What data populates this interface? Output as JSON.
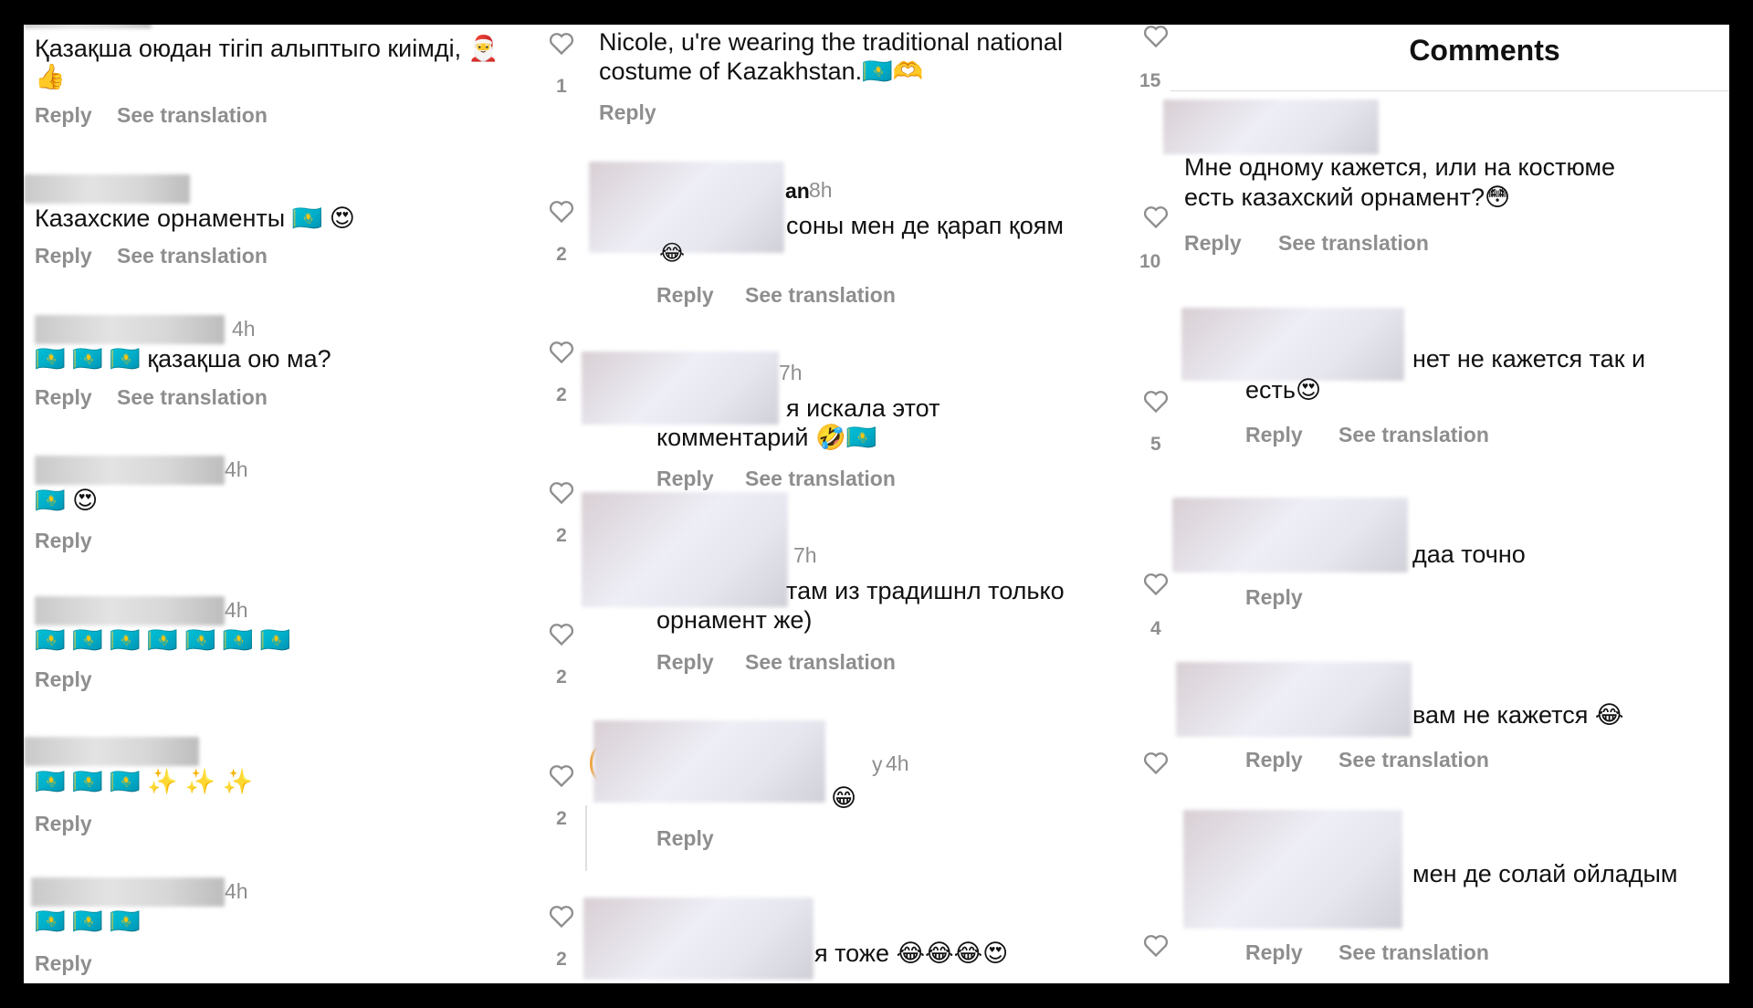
{
  "header": {
    "title": "Comments"
  },
  "actions": {
    "reply": "Reply",
    "see_translation": "See translation"
  },
  "col1": {
    "c1": {
      "text": "Қазақша оюдан тігіп алыптыго киімді, 🎅",
      "text2": "👍"
    },
    "c2": {
      "text": "Казахские орнаменты 🇰🇿 😍"
    },
    "c3": {
      "time": "4h",
      "text": "🇰🇿 🇰🇿 🇰🇿 қазақша ою ма?"
    },
    "c4": {
      "time": "4h",
      "text": "🇰🇿 😍"
    },
    "c5": {
      "time": "4h",
      "text": "🇰🇿 🇰🇿 🇰🇿 🇰🇿 🇰🇿 🇰🇿 🇰🇿"
    },
    "c6": {
      "text": "🇰🇿 🇰🇿 🇰🇿 ✨ ✨ ✨"
    },
    "c7": {
      "time": "4h",
      "text": "🇰🇿 🇰🇿 🇰🇿"
    }
  },
  "col2": {
    "c1": {
      "line1": "Nicole, u're wearing the traditional national",
      "line2": "costume of Kazakhstan.🇰🇿🫶"
    },
    "c2": {
      "name_tail": "an",
      "time": "8h",
      "text": "соны мен де қарап қоям",
      "emoji": "😂"
    },
    "c3": {
      "time": "7h",
      "line1": "я искала этот",
      "line2": "комментарий 🤣🇰🇿"
    },
    "c4": {
      "time": "7h",
      "line1": "там из традишнл только",
      "line2": "орнамент же)"
    },
    "c5": {
      "name_tail": "y",
      "time": "4h",
      "text": "😁"
    },
    "c6": {
      "text": "я тоже 😂😂😂😍"
    }
  },
  "col2_counts": [
    "1",
    "2",
    "2",
    "2",
    "2",
    "2",
    "2"
  ],
  "col3_counts": [
    "15",
    "10",
    "5",
    "4"
  ],
  "col4": {
    "c1": {
      "line1": "Мне одному кажется, или на костюме",
      "line2": "есть казахский орнамент?😳"
    },
    "c2": {
      "line1": "нет не кажется так и",
      "line2": "есть😍"
    },
    "c3": {
      "text": "даа точно"
    },
    "c4": {
      "text": "вам не кажется 😂"
    },
    "c5": {
      "text": "мен де солай ойладым"
    }
  }
}
